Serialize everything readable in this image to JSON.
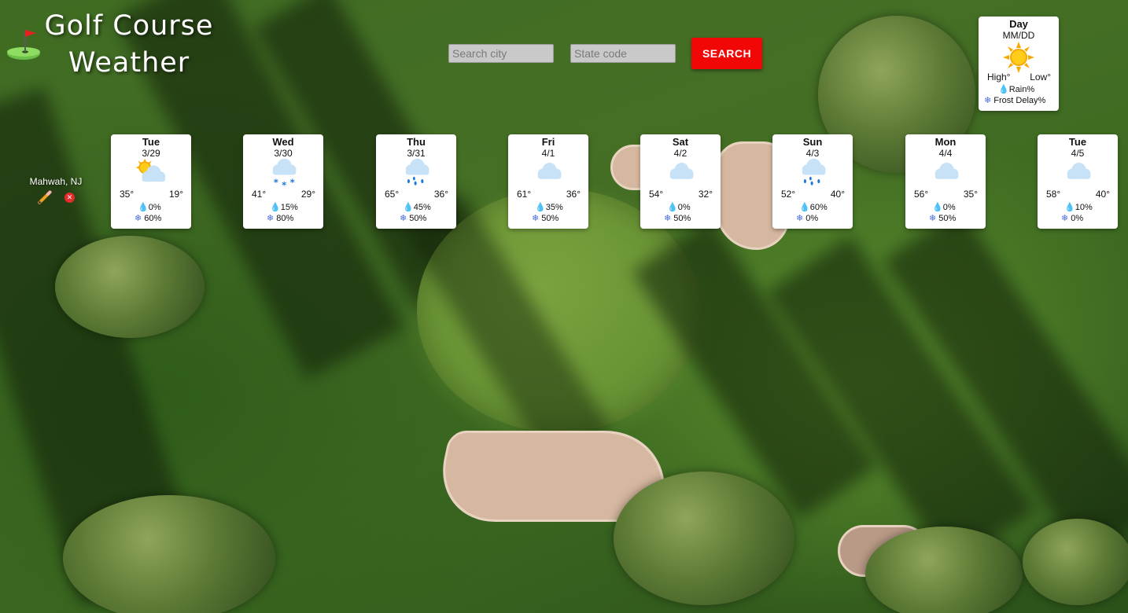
{
  "header": {
    "title_line1": "Golf Course",
    "title_line2": "Weather",
    "logo_icon": "golf-flag-icon"
  },
  "search": {
    "city_placeholder": "Search city",
    "state_placeholder": "State code",
    "button_label": "SEARCH",
    "button_color": "#f20707"
  },
  "legend": {
    "day": "Day",
    "date": "MM/DD",
    "icon": "sun-icon",
    "high": "High°",
    "low": "Low°",
    "rain": "Rain%",
    "frost": "Frost Delay%"
  },
  "saved_location": {
    "name": "Mahwah, NJ",
    "edit_icon": "pencil-icon",
    "delete_icon": "close-icon"
  },
  "forecast": [
    {
      "day": "Tue",
      "date": "3/29",
      "icon": "partly-cloudy-icon",
      "high": "35°",
      "low": "19°",
      "rain": "0%",
      "frost": "60%"
    },
    {
      "day": "Wed",
      "date": "3/30",
      "icon": "snow-icon",
      "high": "41°",
      "low": "29°",
      "rain": "15%",
      "frost": "80%"
    },
    {
      "day": "Thu",
      "date": "3/31",
      "icon": "rain-icon",
      "high": "65°",
      "low": "36°",
      "rain": "45%",
      "frost": "50%"
    },
    {
      "day": "Fri",
      "date": "4/1",
      "icon": "cloud-icon",
      "high": "61°",
      "low": "36°",
      "rain": "35%",
      "frost": "50%"
    },
    {
      "day": "Sat",
      "date": "4/2",
      "icon": "cloud-icon",
      "high": "54°",
      "low": "32°",
      "rain": "0%",
      "frost": "50%"
    },
    {
      "day": "Sun",
      "date": "4/3",
      "icon": "rain-icon",
      "high": "52°",
      "low": "40°",
      "rain": "60%",
      "frost": "0%"
    },
    {
      "day": "Mon",
      "date": "4/4",
      "icon": "cloud-icon",
      "high": "56°",
      "low": "35°",
      "rain": "0%",
      "frost": "50%"
    },
    {
      "day": "Tue",
      "date": "4/5",
      "icon": "cloud-icon",
      "high": "58°",
      "low": "40°",
      "rain": "10%",
      "frost": "0%"
    }
  ]
}
